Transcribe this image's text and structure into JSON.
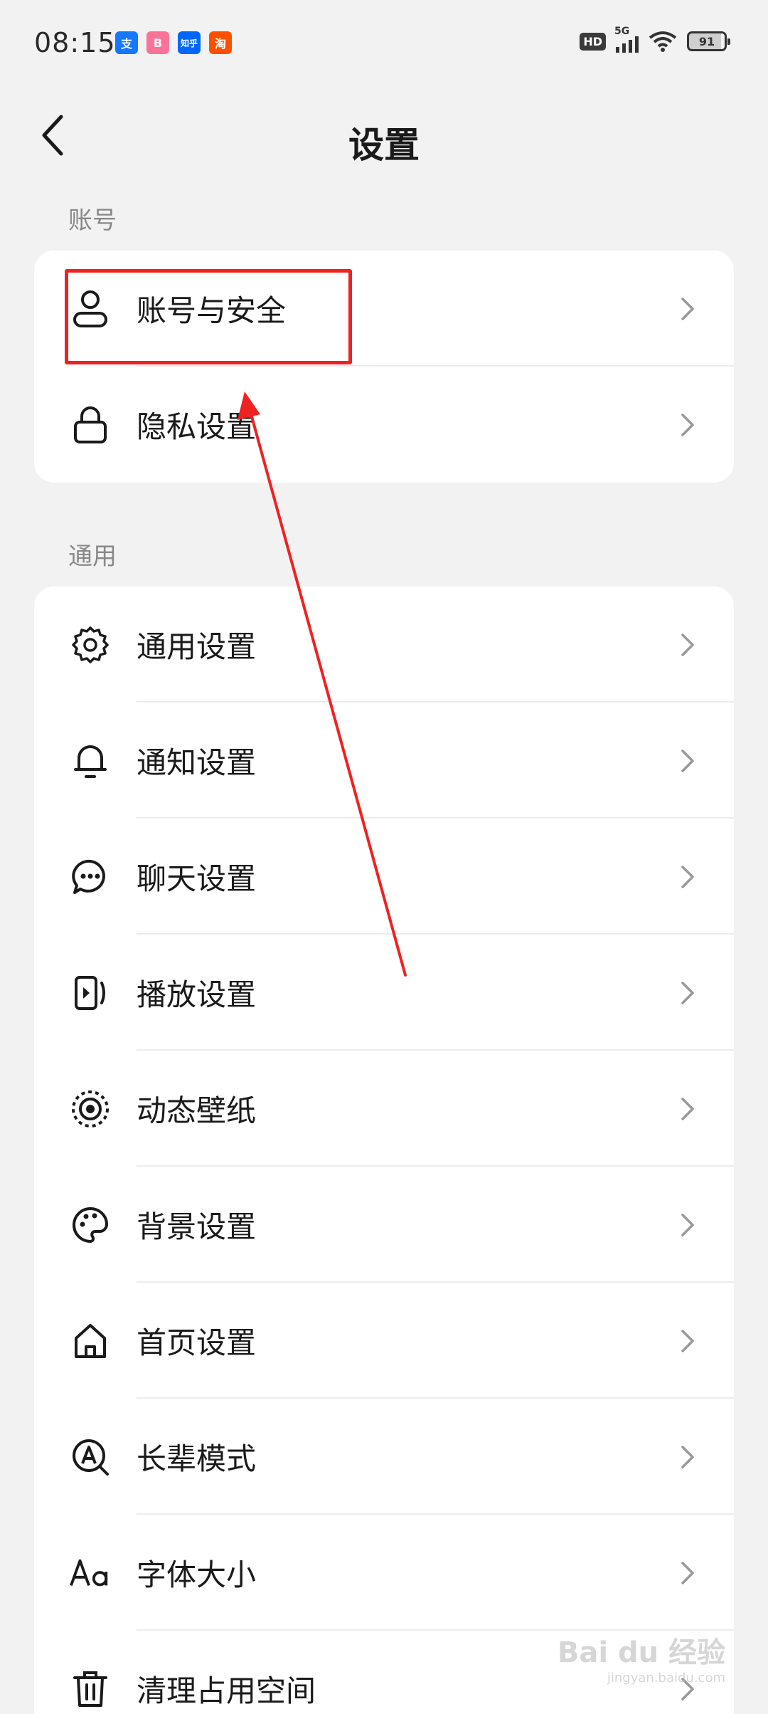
{
  "status_bar": {
    "time": "08:15",
    "notifications": [
      {
        "name": "alipay-icon",
        "glyph": "支",
        "color": "#1677ff"
      },
      {
        "name": "bilibili-icon",
        "glyph": "B",
        "color": "#fb7299"
      },
      {
        "name": "zhihu-icon",
        "glyph": "知乎",
        "color": "#0066ff"
      },
      {
        "name": "taobao-icon",
        "glyph": "淘",
        "color": "#ff5000"
      }
    ],
    "hd": "HD",
    "network": "5G",
    "battery": "91"
  },
  "header": {
    "title": "设置"
  },
  "sections": {
    "account": {
      "label": "账号",
      "items": [
        {
          "label": "账号与安全",
          "icon": "person-icon"
        },
        {
          "label": "隐私设置",
          "icon": "lock-icon"
        }
      ]
    },
    "general": {
      "label": "通用",
      "items": [
        {
          "label": "通用设置",
          "icon": "gear-icon"
        },
        {
          "label": "通知设置",
          "icon": "bell-icon"
        },
        {
          "label": "聊天设置",
          "icon": "chat-bubble-icon"
        },
        {
          "label": "播放设置",
          "icon": "play-screen-icon"
        },
        {
          "label": "动态壁纸",
          "icon": "live-wallpaper-icon"
        },
        {
          "label": "背景设置",
          "icon": "palette-icon"
        },
        {
          "label": "首页设置",
          "icon": "home-icon"
        },
        {
          "label": "长辈模式",
          "icon": "elder-mode-icon"
        },
        {
          "label": "字体大小",
          "icon": "font-size-icon"
        },
        {
          "label": "清理占用空间",
          "icon": "trash-icon"
        }
      ]
    }
  },
  "watermark": {
    "text": "Bai du 经验",
    "sub": "jingyan.baidu.com"
  },
  "colors": {
    "annotation": "#ee2222",
    "background": "#f2f2f2",
    "card": "#ffffff"
  }
}
